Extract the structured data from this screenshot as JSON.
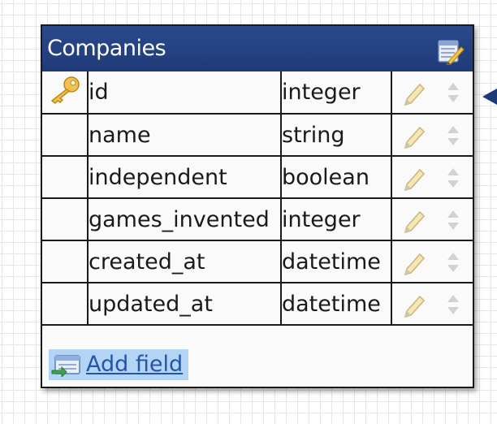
{
  "table": {
    "title": "Companies",
    "fields": [
      {
        "name": "id",
        "type": "integer",
        "primary_key": true
      },
      {
        "name": "name",
        "type": "string",
        "primary_key": false
      },
      {
        "name": "independent",
        "type": "boolean",
        "primary_key": false
      },
      {
        "name": "games_invented",
        "type": "integer",
        "primary_key": false
      },
      {
        "name": "created_at",
        "type": "datetime",
        "primary_key": false
      },
      {
        "name": "updated_at",
        "type": "datetime",
        "primary_key": false
      }
    ],
    "add_field_label": "Add field"
  },
  "icons": {
    "edit_table": "edit-table-icon",
    "primary_key": "key-icon",
    "edit_field": "pencil-icon",
    "reorder": "drag-handle-icon",
    "add_field": "add-field-icon",
    "relation": "relation-arrow-icon"
  },
  "colors": {
    "title_bar": "#1f3a78",
    "title_text": "#ffffff",
    "link": "#2356a8",
    "highlight": "#b3d4f5",
    "grid": "#e6e6e6"
  }
}
